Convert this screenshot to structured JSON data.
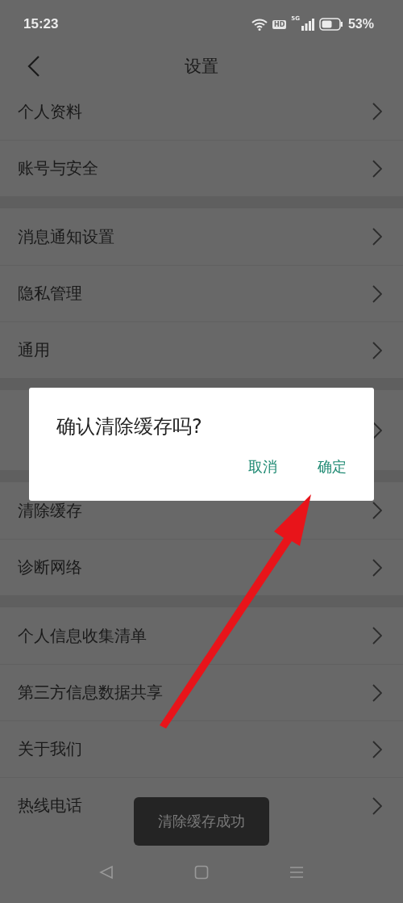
{
  "status_bar": {
    "time": "15:23",
    "hd_badge": "HD",
    "network": "5G",
    "battery": "53%"
  },
  "header": {
    "title": "设置"
  },
  "groups": [
    {
      "items": [
        {
          "title": "个人资料"
        },
        {
          "title": "账号与安全"
        }
      ]
    },
    {
      "items": [
        {
          "title": "消息通知设置"
        },
        {
          "title": "隐私管理"
        },
        {
          "title": "通用"
        }
      ]
    },
    {
      "items": [
        {
          "kind": "covered"
        }
      ]
    },
    {
      "items": [
        {
          "title": "清除缓存"
        },
        {
          "title": "诊断网络"
        }
      ]
    },
    {
      "items": [
        {
          "title": "个人信息收集清单"
        },
        {
          "title": "第三方信息数据共享"
        },
        {
          "title": "关于我们"
        },
        {
          "title": "热线电话"
        }
      ]
    }
  ],
  "dialog": {
    "message": "确认清除缓存吗?",
    "buttons": [
      "取消",
      "确定"
    ]
  },
  "toast": "清除缓存成功"
}
